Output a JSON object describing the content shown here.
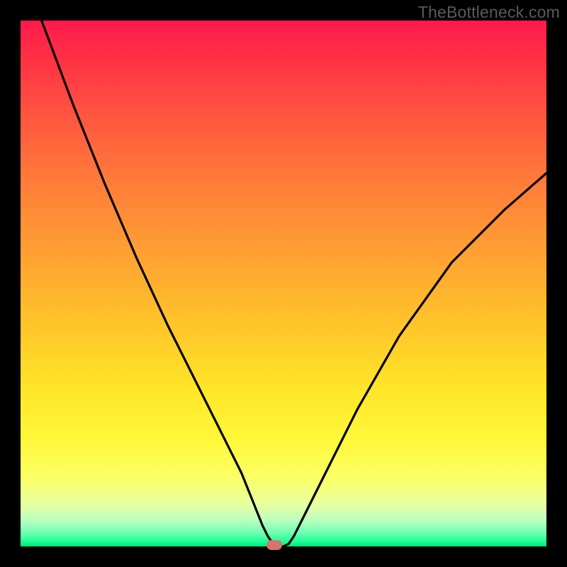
{
  "watermark": "TheBottleneck.com",
  "chart_data": {
    "type": "line",
    "title": "",
    "xlabel": "",
    "ylabel": "",
    "xlim": [
      0,
      100
    ],
    "ylim": [
      0,
      100
    ],
    "grid": false,
    "legend": false,
    "series": [
      {
        "name": "bottleneck-curve",
        "x": [
          4,
          10,
          16,
          22,
          28,
          34,
          38,
          42,
          44,
          46,
          47,
          48,
          49,
          50,
          51,
          52,
          54,
          58,
          64,
          72,
          82,
          92,
          100
        ],
        "y": [
          100,
          84,
          69,
          55,
          42,
          30,
          22,
          14,
          9,
          4,
          2,
          0.5,
          0,
          0,
          0.5,
          2,
          6,
          14,
          26,
          40,
          54,
          64,
          71
        ]
      }
    ],
    "marker": {
      "x": 48.3,
      "y": 0
    },
    "colors": {
      "curve": "#000000",
      "marker": "#d6736b",
      "gradient_top": "#ff1a4d",
      "gradient_bottom": "#00e86e"
    }
  }
}
